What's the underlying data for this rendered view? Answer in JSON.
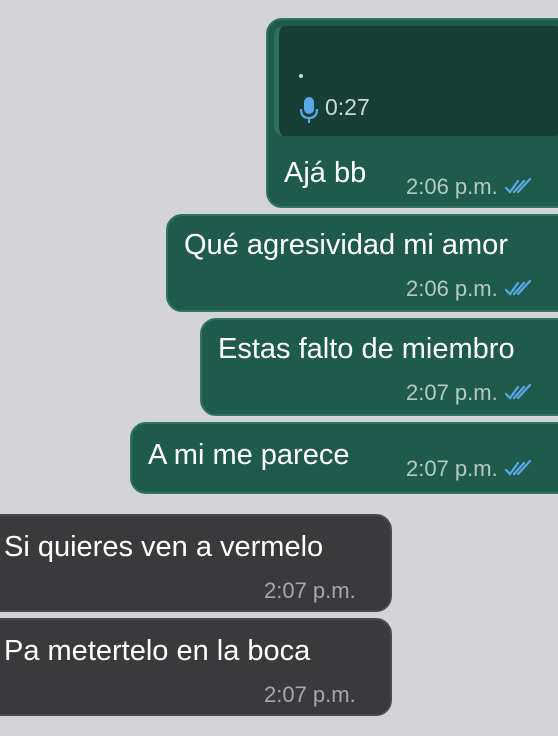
{
  "colors": {
    "background": "#d4d3d6",
    "outgoing_bubble": "#1f5b4d",
    "incoming_bubble": "#3a3a3c",
    "read_ticks": "#5aa9e6"
  },
  "messages": [
    {
      "direction": "outgoing",
      "reply_to": {
        "type": "voice_note",
        "icon": "mic-icon",
        "duration": "0:27"
      },
      "text": "Ajá bb",
      "time": "2:06 p.m.",
      "status": "read"
    },
    {
      "direction": "outgoing",
      "text": "Qué agresividad mi amor",
      "time": "2:06 p.m.",
      "status": "read"
    },
    {
      "direction": "outgoing",
      "text": "Estas falto de miembro",
      "time": "2:07 p.m.",
      "status": "read"
    },
    {
      "direction": "outgoing",
      "text": "A mi me parece",
      "time": "2:07 p.m.",
      "status": "read"
    },
    {
      "direction": "incoming",
      "text": "Si quieres ven a vermelo",
      "time": "2:07 p.m."
    },
    {
      "direction": "incoming",
      "text": "Pa metertelo en la boca",
      "time": "2:07 p.m."
    }
  ]
}
